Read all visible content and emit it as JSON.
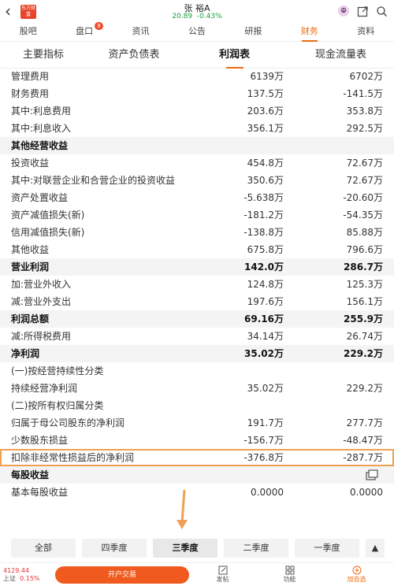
{
  "header": {
    "back_icon": "chevron-left-icon",
    "logo_text": "东方财富",
    "stock_name": "张 裕A",
    "stock_price": "20.89",
    "stock_change": "-0.43%",
    "icons": [
      "avatar-icon",
      "external-link-icon",
      "search-icon"
    ]
  },
  "top_tabs": [
    {
      "label": "股吧"
    },
    {
      "label": "盘口",
      "badge": "8"
    },
    {
      "label": "资讯"
    },
    {
      "label": "公告"
    },
    {
      "label": "研报"
    },
    {
      "label": "财务",
      "active": true
    },
    {
      "label": "资料"
    }
  ],
  "sub_tabs": [
    {
      "label": "主要指标"
    },
    {
      "label": "资产负债表"
    },
    {
      "label": "利润表",
      "active": true
    },
    {
      "label": "现金流量表"
    }
  ],
  "rows": [
    {
      "label": "管理费用",
      "v1": "6139万",
      "v2": "6702万"
    },
    {
      "label": "财务费用",
      "v1": "137.5万",
      "v2": "-141.5万"
    },
    {
      "label": "其中:利息费用",
      "v1": "203.6万",
      "v2": "353.8万"
    },
    {
      "label": "其中:利息收入",
      "v1": "356.1万",
      "v2": "292.5万"
    },
    {
      "label": "其他经营收益",
      "section": true
    },
    {
      "label": "投资收益",
      "v1": "454.8万",
      "v2": "72.67万"
    },
    {
      "label": "其中:对联营企业和合营企业的投资收益",
      "v1": "350.6万",
      "v2": "72.67万"
    },
    {
      "label": "资产处置收益",
      "v1": "-5.638万",
      "v2": "-20.60万"
    },
    {
      "label": "资产减值损失(新)",
      "v1": "-181.2万",
      "v2": "-54.35万"
    },
    {
      "label": "信用减值损失(新)",
      "v1": "-138.8万",
      "v2": "85.88万"
    },
    {
      "label": "其他收益",
      "v1": "675.8万",
      "v2": "796.6万"
    },
    {
      "label": "营业利润",
      "v1": "142.0万",
      "v2": "286.7万",
      "section": true
    },
    {
      "label": "加:营业外收入",
      "v1": "124.8万",
      "v2": "125.3万"
    },
    {
      "label": "减:营业外支出",
      "v1": "197.6万",
      "v2": "156.1万"
    },
    {
      "label": "利润总额",
      "v1": "69.16万",
      "v2": "255.9万",
      "section": true
    },
    {
      "label": "减:所得税费用",
      "v1": "34.14万",
      "v2": "26.74万"
    },
    {
      "label": "净利润",
      "v1": "35.02万",
      "v2": "229.2万",
      "section": true
    },
    {
      "label": "(一)按经营持续性分类",
      "plain": true
    },
    {
      "label": "持续经营净利润",
      "v1": "35.02万",
      "v2": "229.2万"
    },
    {
      "label": "(二)按所有权归属分类",
      "plain": true
    },
    {
      "label": "归属于母公司股东的净利润",
      "v1": "191.7万",
      "v2": "277.7万"
    },
    {
      "label": "少数股东损益",
      "v1": "-156.7万",
      "v2": "-48.47万"
    },
    {
      "label": "扣除非经常性损益后的净利润",
      "v1": "-376.8万",
      "v2": "-287.7万",
      "highlight": true
    },
    {
      "label": "每股收益",
      "section": true,
      "share": true
    },
    {
      "label": "基本每股收益",
      "v1": "0.0000",
      "v2": "0.0000"
    }
  ],
  "period_tabs": [
    {
      "label": "全部"
    },
    {
      "label": "四季度"
    },
    {
      "label": "三季度",
      "active": true
    },
    {
      "label": "二季度"
    },
    {
      "label": "一季度"
    }
  ],
  "bottom": {
    "index_value": "4129.44",
    "index_name": "上证",
    "index_change": "0.15%",
    "open_account": "开户交易",
    "nav": [
      {
        "label": "发帖",
        "icon": "edit-icon"
      },
      {
        "label": "功能",
        "icon": "grid-icon"
      },
      {
        "label": "加自选",
        "icon": "plus-circle-icon",
        "active": true
      }
    ]
  },
  "colors": {
    "accent": "#ec6b12",
    "down": "#1a9e3c",
    "up": "#e33333",
    "highlight_border": "#f0a052"
  }
}
